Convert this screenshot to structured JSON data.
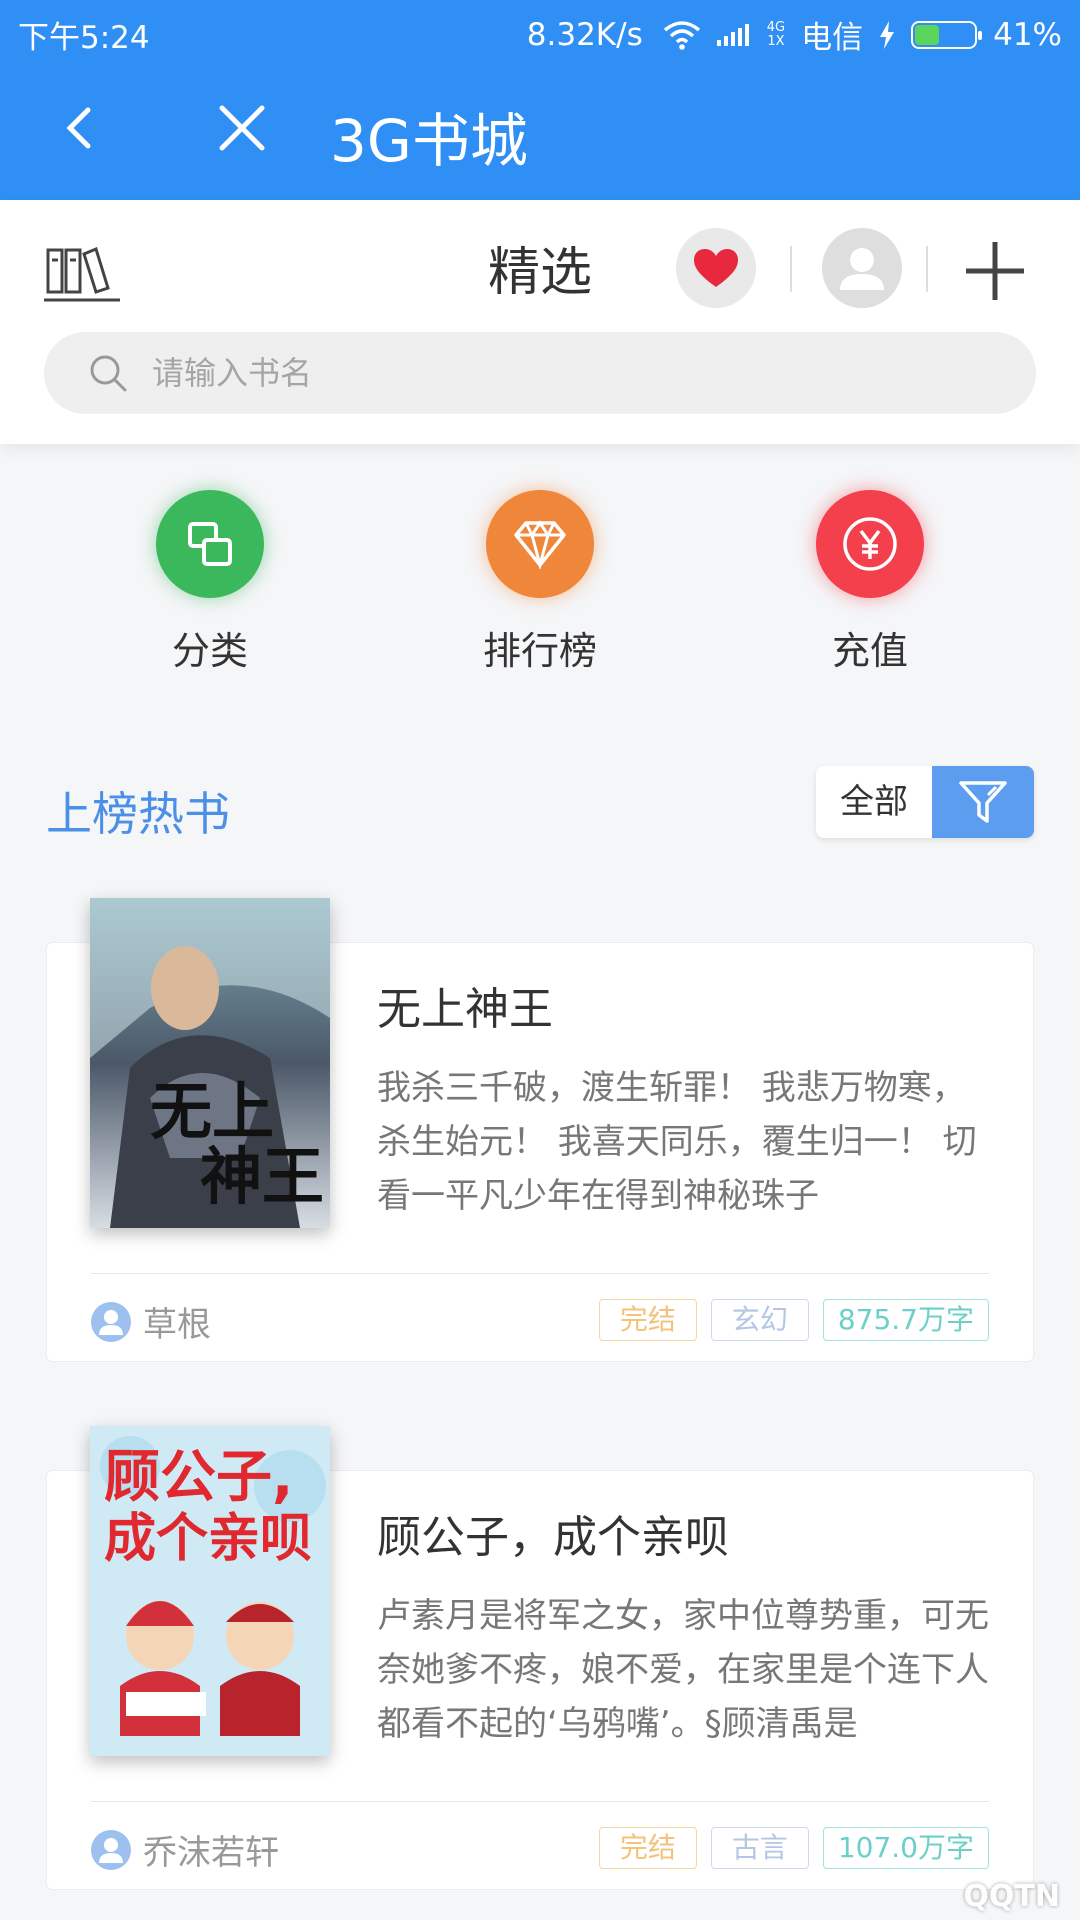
{
  "status_bar": {
    "time": "下午5:24",
    "net_speed": "8.32K/s",
    "signal_type_top": "4G",
    "signal_type_bottom": "1X",
    "carrier": "电信",
    "battery": "41%",
    "battery_level": 0.41
  },
  "titlebar": {
    "title": "3G书城",
    "back_icon": "chevron-left-icon",
    "close_icon": "close-icon"
  },
  "header": {
    "segment_title": "精选",
    "shelf_icon": "bookshelf-icon",
    "heart_icon": "heart-icon",
    "avatar_icon": "user-avatar-icon",
    "plus_icon": "plus-icon",
    "search_placeholder": "请输入书名"
  },
  "quick_entries": [
    {
      "label": "分类",
      "icon": "category-icon",
      "color": "#3bb85c"
    },
    {
      "label": "排行榜",
      "icon": "diamond-icon",
      "color": "#f0863a"
    },
    {
      "label": "充值",
      "icon": "yen-icon",
      "color": "#f3404c"
    }
  ],
  "section": {
    "title": "上榜热书",
    "filter_label": "全部",
    "filter_icon": "filter-icon"
  },
  "books": [
    {
      "title": "无上神王",
      "description": "我杀三千破，渡生斩罪！ 我悲万物寒，杀生始元！ 我喜天同乐，覆生归一！ 切看一平凡少年在得到神秘珠子",
      "author": "草根",
      "tags": [
        "完结",
        "玄幻",
        "875.7万字"
      ],
      "cover_text": "无上神王"
    },
    {
      "title": "顾公子，成个亲呗",
      "description": "卢素月是将军之女，家中位尊势重，可无奈她爹不疼，娘不爱，在家里是个连下人都看不起的‘乌鸦嘴’。§顾清禹是",
      "author": "乔沫若轩",
      "tags": [
        "完结",
        "古言",
        "107.0万字"
      ],
      "cover_text": "顾公子，成个亲呗"
    }
  ]
}
